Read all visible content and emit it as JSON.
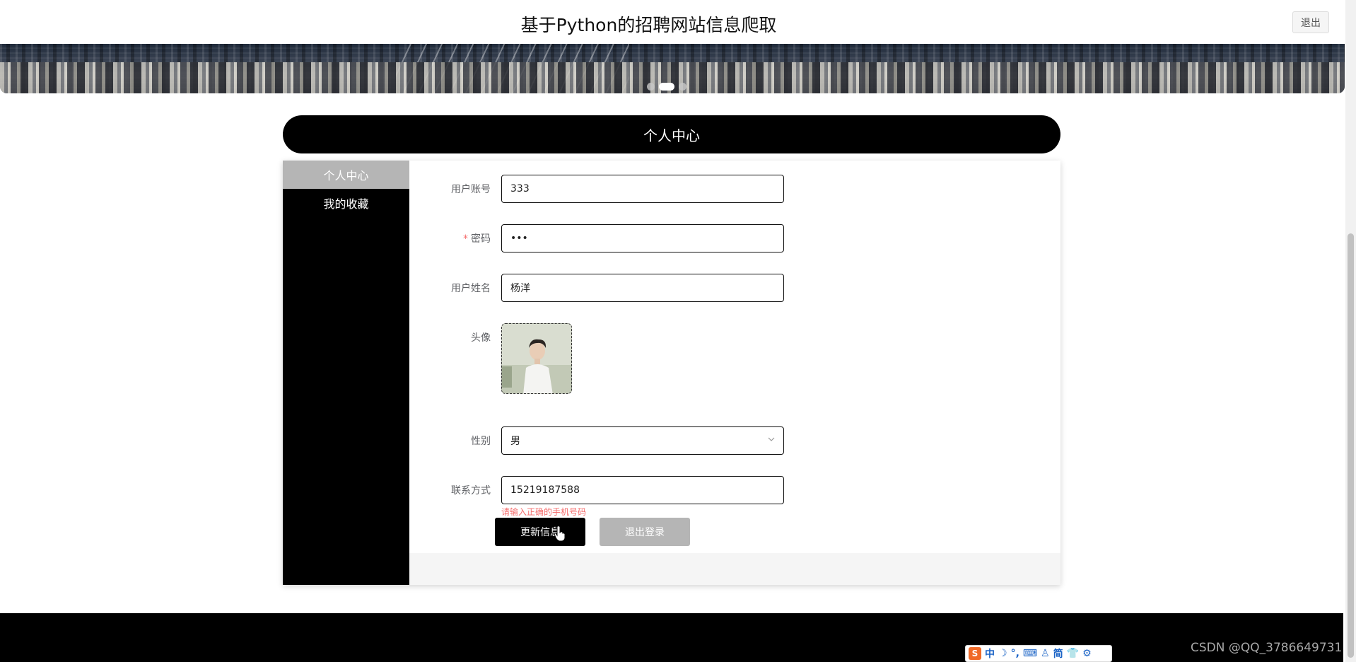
{
  "header": {
    "site_title": "基于Python的招聘网站信息爬取",
    "logout_label": "退出"
  },
  "banner": {
    "slides": 3,
    "active_slide": 2
  },
  "section": {
    "title": "个人中心"
  },
  "sidebar": {
    "items": [
      {
        "label": "个人中心",
        "active": true
      },
      {
        "label": "我的收藏",
        "active": false
      }
    ]
  },
  "form": {
    "account_label": "用户账号",
    "account_value": "333",
    "password_required_mark": "*",
    "password_label": "密码",
    "password_value": "•••",
    "name_label": "用户姓名",
    "name_value": "杨洋",
    "avatar_label": "头像",
    "gender_label": "性别",
    "gender_value": "男",
    "contact_label": "联系方式",
    "contact_value": "15219187588",
    "contact_error": "请输入正确的手机号码",
    "update_button": "更新信息",
    "logout_button": "退出登录"
  },
  "ime_toolbar": {
    "logo": "S",
    "items": [
      "中",
      "☽",
      "°,",
      "⌨",
      "♙",
      "简",
      "👕",
      "⚙"
    ]
  },
  "watermark": "CSDN @QQ_3786649731",
  "colors": {
    "primary": "#000000",
    "active_nav": "#b5b5b5",
    "error": "#f56c6c",
    "ime_brand": "#f06a28"
  }
}
